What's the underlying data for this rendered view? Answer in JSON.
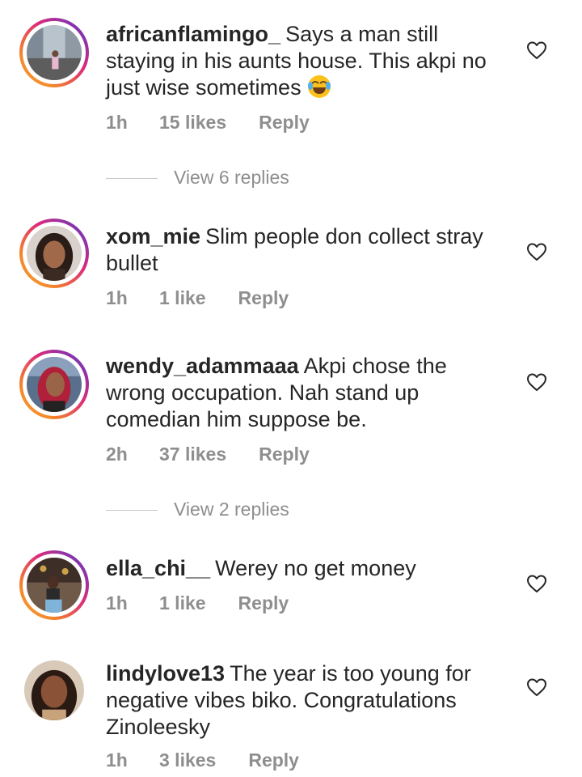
{
  "comments": [
    {
      "username": "africanflamingo_",
      "text": "Says a man still staying in his aunts house. This akpi no just wise sometimes",
      "emoji": "face-with-tears-of-joy",
      "time": "1h",
      "likes": "15 likes",
      "reply": "Reply",
      "story_ring": true,
      "view_replies": "View 6 replies"
    },
    {
      "username": "xom_mie",
      "text": "Slim people don collect stray bullet",
      "time": "1h",
      "likes": "1 like",
      "reply": "Reply",
      "story_ring": true
    },
    {
      "username": "wendy_adammaaa",
      "text": "Akpi chose the wrong occupation. Nah stand up comedian him suppose be.",
      "time": "2h",
      "likes": "37 likes",
      "reply": "Reply",
      "story_ring": true,
      "view_replies": "View 2 replies"
    },
    {
      "username": "ella_chi__",
      "text": "Werey no get money",
      "time": "1h",
      "likes": "1 like",
      "reply": "Reply",
      "story_ring": true
    },
    {
      "username": "lindylove13",
      "text": "The year is too young  for negative vibes biko. Congratulations Zinoleesky",
      "time": "1h",
      "likes": "3 likes",
      "reply": "Reply",
      "story_ring": false
    }
  ],
  "icons": {
    "like": "heart-outline-icon",
    "emoji": "face-with-tears-of-joy"
  },
  "colors": {
    "text": "#262626",
    "secondary": "#8e8e8e",
    "story_ring_start": "#f58529",
    "story_ring_end": "#8134af"
  }
}
